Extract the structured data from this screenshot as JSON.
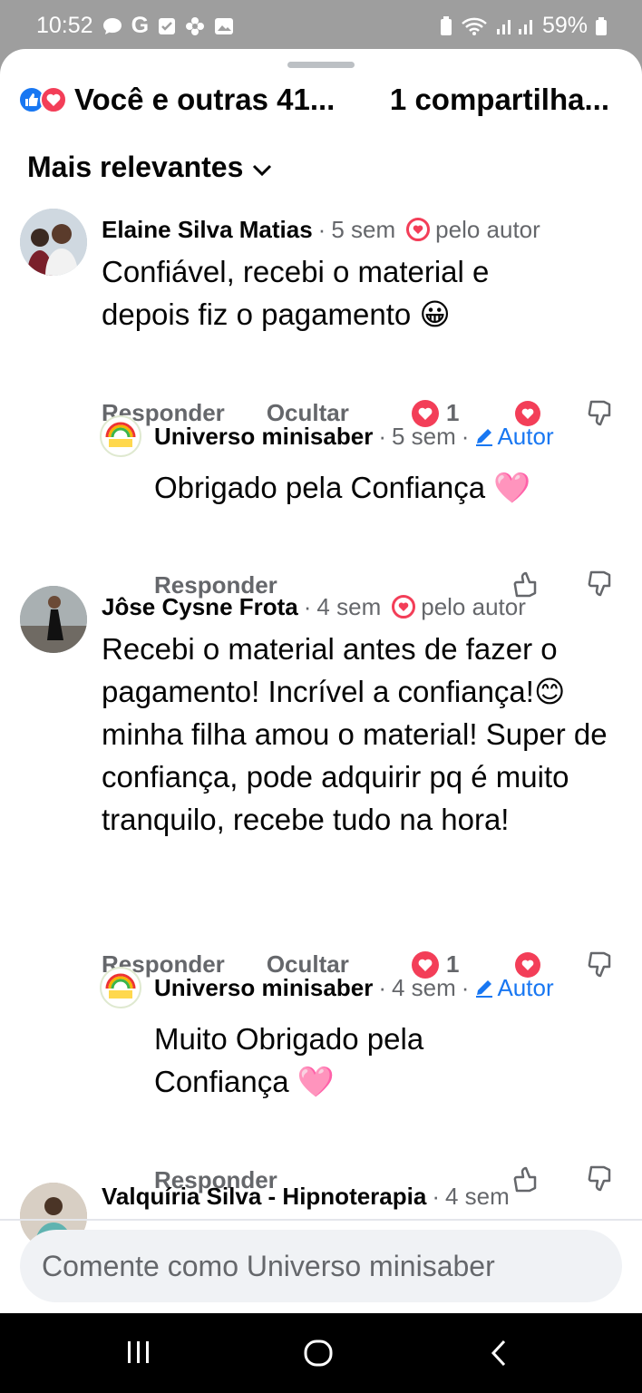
{
  "status_bar": {
    "time": "10:52",
    "battery": "59%"
  },
  "reactions": {
    "summary": "Você e outras 41...",
    "shares": "1 compartilha..."
  },
  "sort": {
    "label": "Mais relevantes"
  },
  "comments": [
    {
      "name": "Elaine Silva Matias",
      "time": "5 sem",
      "badge": "pelo autor",
      "text": "Confiável, recebi o material e depois fiz o pagamento 😀",
      "reply_label": "Responder",
      "hide_label": "Ocultar",
      "love_count": "1"
    },
    {
      "name": "Universo minisaber",
      "time": "5 sem",
      "badge": "Autor",
      "text": "Obrigado pela Confiança 🩷",
      "reply_label": "Responder"
    },
    {
      "name": "Jôse Cysne Frota",
      "time": "4 sem",
      "badge": "pelo autor",
      "text": "Recebi o material antes de fazer o pagamento! Incrível a confiança!😊 minha filha amou o material! Super de confiança, pode adquirir pq é muito tranquilo, recebe tudo na hora!",
      "reply_label": "Responder",
      "hide_label": "Ocultar",
      "love_count": "1"
    },
    {
      "name": "Universo minisaber",
      "time": "4 sem",
      "badge": "Autor",
      "text": "Muito Obrigado pela Confiança 🩷",
      "reply_label": "Responder"
    },
    {
      "name": "Valquíria Silva - Hipnoterapia",
      "time": "4 sem"
    }
  ],
  "composer": {
    "placeholder": "Comente como Universo minisaber"
  },
  "colors": {
    "brand_blue": "#1877f2",
    "love_red": "#f33e58",
    "secondary_text": "#65676b"
  }
}
